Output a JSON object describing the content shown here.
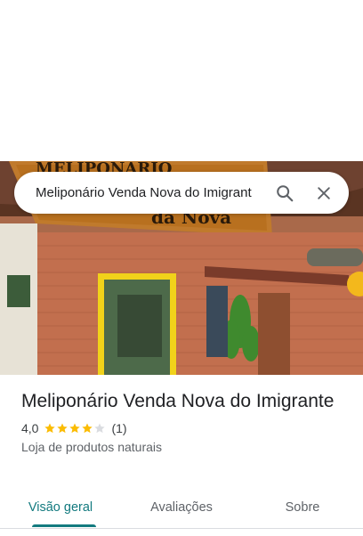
{
  "search": {
    "query": "Meliponário Venda Nova do Imigrant"
  },
  "hero": {
    "sign_text_top": "MELIPONÁRIO",
    "sign_text_bottom": "da Nova"
  },
  "place": {
    "title": "Meliponário Venda Nova do Imigrante",
    "rating": "4,0",
    "stars_filled": 4,
    "stars_total": 5,
    "review_count": "(1)",
    "category": "Loja de produtos naturais"
  },
  "tabs": [
    {
      "label": "Visão geral",
      "active": true
    },
    {
      "label": "Avaliações",
      "active": false
    },
    {
      "label": "Sobre",
      "active": false
    }
  ],
  "colors": {
    "accent": "#137a7f",
    "star": "#fbbc04",
    "star_empty": "#dadce0"
  }
}
